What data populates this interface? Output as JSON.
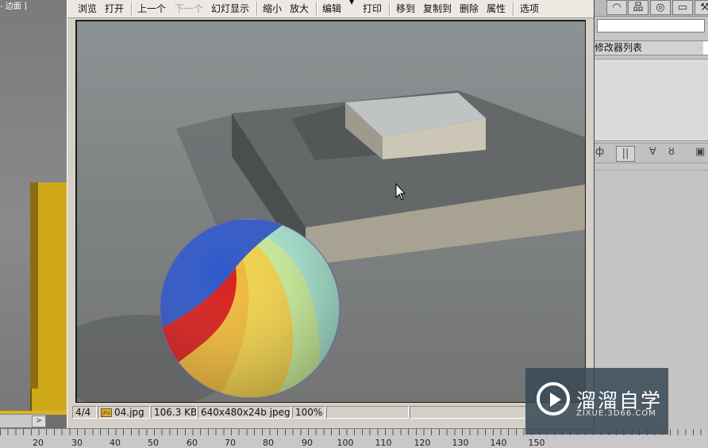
{
  "viewport_left": {
    "label": "- 边面 ]"
  },
  "toolbar": {
    "buttons": [
      {
        "label": "浏览"
      },
      {
        "label": "打开"
      },
      {
        "label": "上一个"
      },
      {
        "label": "下一个",
        "disabled": true
      },
      {
        "label": "幻灯显示"
      },
      {
        "label": "缩小"
      },
      {
        "label": "放大"
      },
      {
        "label": "编辑"
      },
      {
        "label": "打印"
      },
      {
        "label": "移到"
      },
      {
        "label": "复制到"
      },
      {
        "label": "删除"
      },
      {
        "label": "属性"
      },
      {
        "label": "选项"
      }
    ]
  },
  "statusbar": {
    "index": "4/4",
    "file_icon": "JPG",
    "filename": "04.jpg",
    "filesize": "106.3 KB",
    "dimensions": "640x480x24b jpeg",
    "zoom": "100%"
  },
  "right_panel": {
    "modifier_list_label": "修改器列表"
  },
  "ruler": {
    "ticks": [
      "20",
      "30",
      "40",
      "50",
      "60",
      "70",
      "80",
      "90",
      "100",
      "110",
      "120",
      "130",
      "140",
      "150"
    ]
  },
  "watermark": {
    "title": "溜溜自学",
    "url": "ZIXUE.3D66.COM"
  },
  "colors": {
    "sphere_blue": "#2f57c8",
    "sphere_red": "#d81f1c",
    "sphere_yellow": "#f2d24a",
    "sphere_mint": "#a7e6d0",
    "ground": "#7d7e7d",
    "platform_top": "#656868",
    "box_front": "#ccc6b6",
    "watermark_bg": "#384856"
  }
}
